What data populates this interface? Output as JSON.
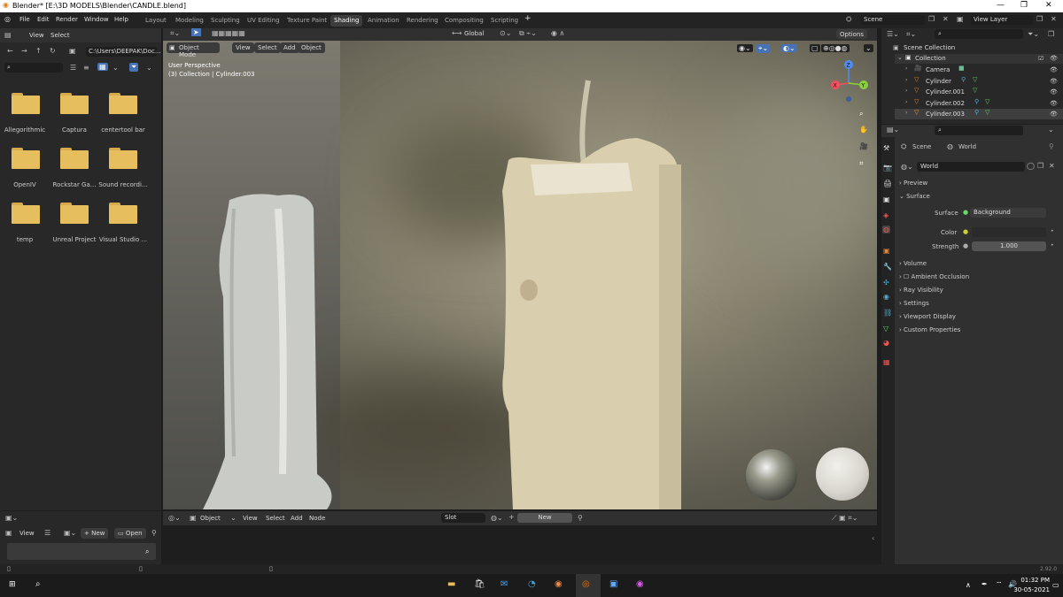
{
  "window": {
    "title": "Blender* [E:\\3D MODELS\\Blender\\CANDLE.blend]",
    "minimize": "—",
    "maximize": "❐",
    "close": "✕"
  },
  "menu": [
    "File",
    "Edit",
    "Render",
    "Window",
    "Help"
  ],
  "workspaces": [
    "Layout",
    "Modeling",
    "Sculpting",
    "UV Editing",
    "Texture Paint",
    "Shading",
    "Animation",
    "Rendering",
    "Compositing",
    "Scripting"
  ],
  "scene_field": "Scene",
  "viewlayer_field": "View Layer",
  "filebrowser": {
    "view": "View",
    "select": "Select",
    "path": "C:\\Users\\DEEPAK\\Doc...",
    "folders": [
      "Allegorithmic",
      "Captura",
      "centertool bar",
      "OpenIV",
      "Rockstar Ga...",
      "Sound recordi...",
      "temp",
      "Unreal Project",
      "Visual Studio ..."
    ]
  },
  "viewport": {
    "mode": "Object Mode",
    "view": "View",
    "select": "Select",
    "add": "Add",
    "object": "Object",
    "orientation": "Global",
    "options": "Options",
    "info_line1": "User Perspective",
    "info_line2": "(3) Collection | Cylinder.003",
    "gizmo": {
      "x": "X",
      "y": "Y",
      "z": "Z"
    }
  },
  "node_editor": {
    "object": "Object",
    "view": "View",
    "select": "Select",
    "add": "Add",
    "node": "Node",
    "slot": "Slot",
    "new": "New"
  },
  "image_editor": {
    "view": "View",
    "new": "New",
    "open": "Open"
  },
  "outliner": {
    "scene_collection": "Scene Collection",
    "collection": "Collection",
    "items": [
      "Camera",
      "Cylinder",
      "Cylinder.001",
      "Cylinder.002",
      "Cylinder.003"
    ]
  },
  "properties": {
    "scene_tab": "Scene",
    "world_tab": "World",
    "world_name": "World",
    "preview": "Preview",
    "surface": "Surface",
    "surface_label": "Surface",
    "surface_value": "Background",
    "color_label": "Color",
    "strength_label": "Strength",
    "strength_value": "1.000",
    "volume": "Volume",
    "ambient_occlusion": "Ambient Occlusion",
    "ray_visibility": "Ray Visibility",
    "settings": "Settings",
    "viewport_display": "Viewport Display",
    "custom_properties": "Custom Properties"
  },
  "version": "2.92.0",
  "taskbar": {
    "time": "01:32 PM",
    "date": "30-05-2021"
  },
  "colors": {
    "accent": "#4772b3",
    "folder": "#e7be5e",
    "taskbar": "#1b1b1b"
  }
}
